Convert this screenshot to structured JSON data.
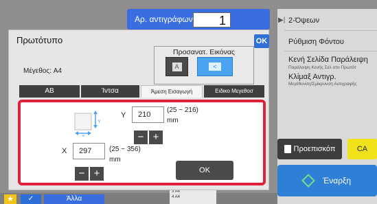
{
  "copies": {
    "label": "Αρ. αντιγράφων",
    "value": "1"
  },
  "right_panel": {
    "items": [
      {
        "label": "2-Όψεων"
      },
      {
        "label": "Ρύθμιση Φόντου"
      },
      {
        "label": "Κενή Σελίδα Παράλειψη",
        "sub": "Παράλειψη Κενής Σελ στο Πρωτότ"
      },
      {
        "label": "Κλίμαξ Αντιγρ.",
        "sub": "Μεγέθυνση/Σμίκρυνση Αντιγραφής"
      }
    ],
    "preview": "Προεπισκόπ",
    "ca": "CA",
    "start": "Έναρξη"
  },
  "bottom": {
    "other": "Άλλα",
    "mini_rows": [
      "3  A4",
      "4  A4"
    ]
  },
  "dialog": {
    "title": "Πρωτότυπο",
    "ok": "OK",
    "size_label": "Μέγεθος: A4",
    "orientation": {
      "label": "Προσανατ. Εικόνας",
      "a_glyph": "A",
      "b_glyph": "<"
    },
    "tabs": [
      "AB",
      "Ίντσα",
      "Άμεση Εισαγωγή",
      "Ειδικο Μεγεθοσ"
    ],
    "active_tab": 2,
    "y": {
      "label": "Y",
      "value": "210",
      "range": "(25 ~ 216)",
      "unit": "mm"
    },
    "x": {
      "label": "X",
      "value": "297",
      "range": "(25 ~ 356)",
      "unit": "mm"
    },
    "minus": "−",
    "plus": "+",
    "ok_button": "OK",
    "icon_axis_y": "Y",
    "icon_axis_x": "X"
  },
  "colors": {
    "accent_blue": "#2f6fd6",
    "highlight_red": "#e0203a",
    "ca_yellow": "#f2e21b"
  }
}
